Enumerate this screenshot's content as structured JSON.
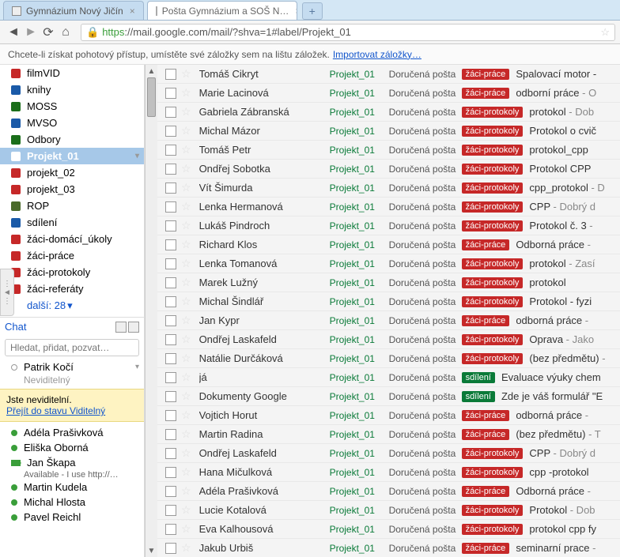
{
  "tabs": {
    "t1": "Gymnázium Nový Jičín",
    "t2": "Pošta Gymnázium a SOŠ N…"
  },
  "url": {
    "scheme": "https",
    "rest": "://mail.google.com/mail/?shva=1#label/Projekt_01"
  },
  "bookmark_hint": "Chcete-li získat pohotový přístup, umístěte své záložky sem na lištu záložek.",
  "bookmark_link": "Importovat záložky…",
  "labels": [
    {
      "name": "filmVID",
      "color": "#c62828"
    },
    {
      "name": "knihy",
      "color": "#1a5aa8"
    },
    {
      "name": "MOSS",
      "color": "#1a6e1a"
    },
    {
      "name": "MVSO",
      "color": "#1a5aa8"
    },
    {
      "name": "Odbory",
      "color": "#1a6e1a"
    },
    {
      "name": "Projekt_01",
      "color": "#ffffff",
      "active": true
    },
    {
      "name": "projekt_02",
      "color": "#c62828"
    },
    {
      "name": "projekt_03",
      "color": "#c62828"
    },
    {
      "name": "ROP",
      "color": "#4a6a2a"
    },
    {
      "name": "sdílení",
      "color": "#1a5aa8"
    },
    {
      "name": "žáci-domácí_úkoly",
      "color": "#c62828"
    },
    {
      "name": "žáci-práce",
      "color": "#c62828"
    },
    {
      "name": "žáci-protokoly",
      "color": "#c62828"
    },
    {
      "name": "žáci-referáty",
      "color": "#c62828"
    }
  ],
  "more_label": "další: 28",
  "chat": {
    "title": "Chat",
    "search_placeholder": "Hledat, přidat, pozvat…",
    "me": {
      "name": "Patrik Kočí",
      "status": "Neviditelný"
    },
    "banner_line1": "Jste neviditelní.",
    "banner_link": "Přejít do stavu Viditelný",
    "contacts": [
      {
        "name": "Adéla Prašivková",
        "online": true
      },
      {
        "name": "Eliška Oborná",
        "online": true
      },
      {
        "name": "Jan Škapa",
        "camera": true,
        "sub": "Available - I use http://…"
      },
      {
        "name": "Martin Kudela",
        "online": true
      },
      {
        "name": "Michal Hlosta",
        "online": true
      },
      {
        "name": "Pavel Reichl",
        "online": true
      }
    ]
  },
  "proj_label": "Projekt_01",
  "inbox_label": "Doručená pošta",
  "tag_colors": {
    "žáci-práce": "#c62828",
    "žáci-protokoly": "#c62828",
    "sdílení": "#0a7a38"
  },
  "mails": [
    {
      "sender": "Tomáš Cikryt",
      "tag": "žáci-práce",
      "subject": "Spalovací motor -",
      "suffix": ""
    },
    {
      "sender": "Marie Lacinová",
      "tag": "žáci-práce",
      "subject": "odborní práce",
      "suffix": " - O"
    },
    {
      "sender": "Gabriela Zábranská",
      "tag": "žáci-protokoly",
      "subject": "protokol",
      "suffix": " - Dob"
    },
    {
      "sender": "Michal Mázor",
      "tag": "žáci-protokoly",
      "subject": "Protokol o cvič",
      "suffix": ""
    },
    {
      "sender": "Tomáš Petr",
      "tag": "žáci-protokoly",
      "subject": "protokol_cpp",
      "suffix": ""
    },
    {
      "sender": "Ondřej Sobotka",
      "tag": "žáci-protokoly",
      "subject": "Protokol CPP",
      "suffix": ""
    },
    {
      "sender": "Vít Šimurda",
      "tag": "žáci-protokoly",
      "subject": "cpp_protokol",
      "suffix": " - D"
    },
    {
      "sender": "Lenka Hermanová",
      "tag": "žáci-protokoly",
      "subject": "CPP",
      "suffix": " - Dobrý d"
    },
    {
      "sender": "Lukáš Pindroch",
      "tag": "žáci-protokoly",
      "subject": "Protokol č. 3",
      "suffix": " -"
    },
    {
      "sender": "Richard Klos",
      "tag": "žáci-práce",
      "subject": "Odborná práce",
      "suffix": " -"
    },
    {
      "sender": "Lenka Tomanová",
      "tag": "žáci-protokoly",
      "subject": "protokol",
      "suffix": " - Zasí"
    },
    {
      "sender": "Marek Lužný",
      "tag": "žáci-protokoly",
      "subject": "protokol",
      "suffix": ""
    },
    {
      "sender": "Michal Šindlář",
      "tag": "žáci-protokoly",
      "subject": "Protokol - fyzi",
      "suffix": ""
    },
    {
      "sender": "Jan Kypr",
      "tag": "žáci-práce",
      "subject": "odborná práce",
      "suffix": " -"
    },
    {
      "sender": "Ondřej Laskafeld",
      "tag": "žáci-protokoly",
      "subject": "Oprava",
      "suffix": " - Jako"
    },
    {
      "sender": "Natálie Durčáková",
      "tag": "žáci-protokoly",
      "subject": "(bez předmětu)",
      "suffix": " -"
    },
    {
      "sender": "já",
      "tag": "sdílení",
      "subject": "Evaluace výuky chem",
      "suffix": ""
    },
    {
      "sender": "Dokumenty Google",
      "tag": "sdílení",
      "subject": "Zde je váš formulář \"E",
      "suffix": ""
    },
    {
      "sender": "Vojtich Horut",
      "tag": "žáci-práce",
      "subject": "odborná práce",
      "suffix": " -"
    },
    {
      "sender": "Martin Radina",
      "tag": "žáci-práce",
      "subject": "(bez předmětu)",
      "suffix": " - T"
    },
    {
      "sender": "Ondřej Laskafeld",
      "tag": "žáci-protokoly",
      "subject": "CPP",
      "suffix": " - Dobrý d"
    },
    {
      "sender": "Hana Mičulková",
      "tag": "žáci-protokoly",
      "subject": "cpp -protokol",
      "suffix": ""
    },
    {
      "sender": "Adéla Prašivková",
      "tag": "žáci-práce",
      "subject": "Odborná práce",
      "suffix": " -"
    },
    {
      "sender": "Lucie Kotalová",
      "tag": "žáci-protokoly",
      "subject": "Protokol",
      "suffix": " - Dob"
    },
    {
      "sender": "Eva Kalhousová",
      "tag": "žáci-protokoly",
      "subject": "protokol cpp fy",
      "suffix": ""
    },
    {
      "sender": "Jakub Urbiš",
      "tag": "žáci-práce",
      "subject": "seminarní prace",
      "suffix": " -"
    }
  ]
}
